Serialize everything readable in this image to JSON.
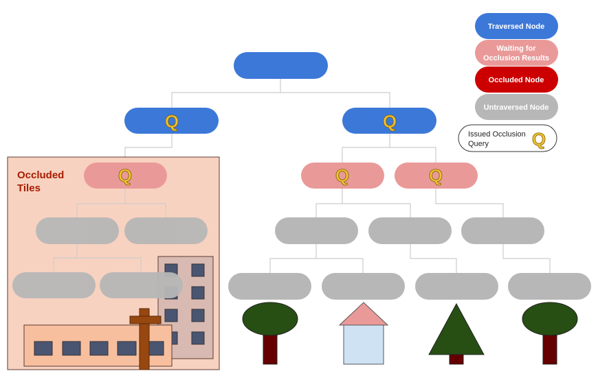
{
  "colors": {
    "traversed": "#3c78d8",
    "waiting": "#ea9999",
    "occluded": "#cc0000",
    "untraversed": "#b7b7b7",
    "query": "#f1c232",
    "tile": "#f8d2c0"
  },
  "legend": {
    "traversed": "Traversed Node",
    "waiting_1": "Waiting for",
    "waiting_2": "Occlusion Results",
    "occluded": "Occluded Node",
    "untraversed": "Untraversed Node",
    "query_1": "Issued Occlusion",
    "query_2": "Query"
  },
  "tile_label_1": "Occluded",
  "tile_label_2": "Tiles",
  "query_glyph": "Q"
}
